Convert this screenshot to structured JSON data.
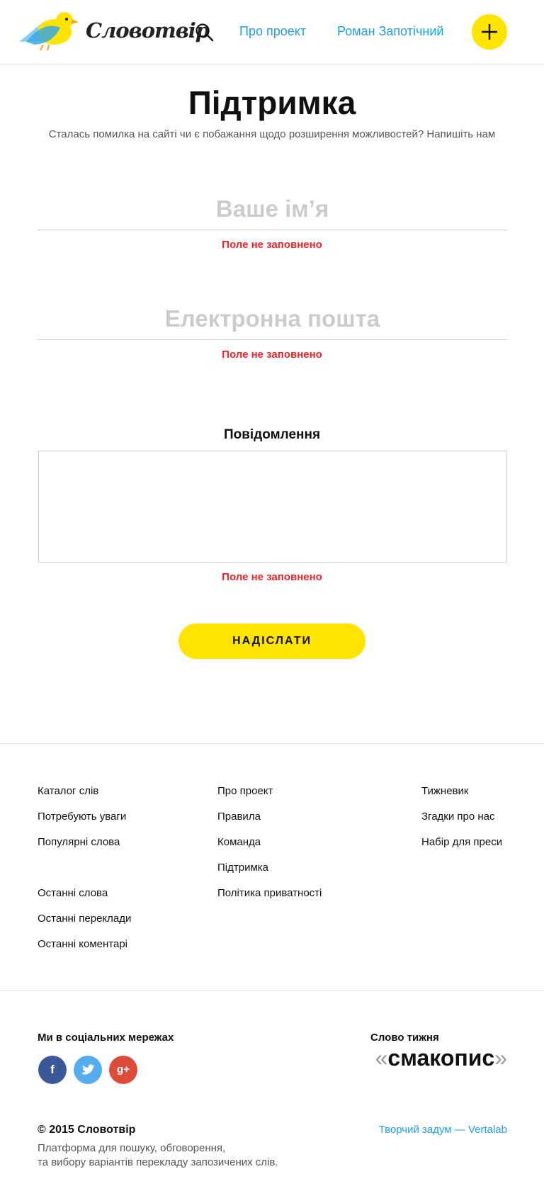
{
  "header": {
    "logo_text": "Словотвір",
    "nav": {
      "about": "Про проект",
      "user": "Роман Запотічний"
    }
  },
  "main": {
    "title": "Підтримка",
    "subtitle": "Сталась помилка на сайті чи є побажання щодо розширення можливостей? Напишіть нам",
    "name_placeholder": "Ваше ім’я",
    "email_placeholder": "Електронна пошта",
    "message_label": "Повідомлення",
    "error_text": "Поле не заповнено",
    "submit_label": "НАДІСЛАТИ"
  },
  "footer": {
    "col1": [
      "Каталог слів",
      "Потребують уваги",
      "Популярні слова",
      "Останні слова",
      "Останні переклади",
      "Останні коментарі"
    ],
    "col2": [
      "Про проект",
      "Правила",
      "Команда",
      "Підтримка",
      "Політика приватності"
    ],
    "col3": [
      "Тижневик",
      "Згадки про нас",
      "Набір для преси"
    ],
    "social_title": "Ми в соціальних мережах",
    "word_of_week_title": "Слово тижня",
    "word_of_week": "смакопис",
    "quote_open": "«",
    "quote_close": "»",
    "copyright": "© 2015 Словотвір",
    "tagline_1": "Платформа для пошуку, обговорення,",
    "tagline_2": "та вибору варіантів перекладу запозичених слів.",
    "credit": "Творчий задум — Vertalab"
  },
  "colors": {
    "accent_yellow": "#ffe400",
    "link_blue": "#1ea0e6",
    "error_red": "#e8232a"
  }
}
